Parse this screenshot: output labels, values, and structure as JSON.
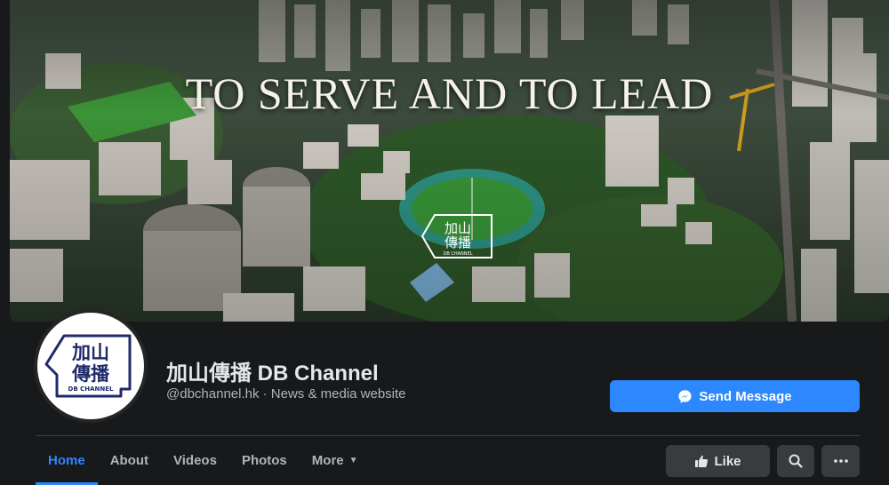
{
  "cover": {
    "slogan": "TO SERVE AND TO LEAD"
  },
  "logo": {
    "line1": "加山",
    "line2": "傳播",
    "caption": "DB CHANNEL"
  },
  "page": {
    "name": "加山傳播 DB Channel",
    "subtitle": "@dbchannel.hk · News & media website"
  },
  "actions": {
    "send_message": "Send Message",
    "like": "Like",
    "more_icon": "more-horizontal-icon",
    "search_icon": "search-icon"
  },
  "tabs": [
    {
      "label": "Home",
      "active": true
    },
    {
      "label": "About"
    },
    {
      "label": "Videos"
    },
    {
      "label": "Photos"
    },
    {
      "label": "More"
    }
  ],
  "colors": {
    "background": "#18191a",
    "surface": "#242526",
    "accent": "#2d88ff",
    "button_secondary": "#3a3b3c",
    "logo_navy": "#1f2a6b"
  }
}
